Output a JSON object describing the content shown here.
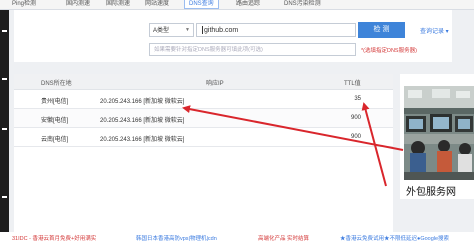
{
  "nav": {
    "tabs": [
      "Ping检测",
      "国内测速",
      "国际测速",
      "网站速度",
      "DNS查询",
      "路由追踪",
      "DNS污染检测"
    ],
    "active_index": 4
  },
  "query": {
    "record_type": "A类型",
    "domain": "github.com",
    "detect_label": "检 测",
    "history_label": "查询记录 ▾",
    "dns_placeholder": "如果需要针对指定DNS服务器可填此项(可选)",
    "optional_note": "*(选填指定DNS服务器)"
  },
  "table": {
    "headers": [
      "DNS所在地",
      "响应IP",
      "TTL值"
    ],
    "rows": [
      {
        "location": "贵州[电信]",
        "ip": "20.205.243.166 [新加坡 微软云]",
        "ttl": "35"
      },
      {
        "location": "安徽[电信]",
        "ip": "20.205.243.166 [新加坡 微软云]",
        "ttl": "900"
      },
      {
        "location": "云南[电信]",
        "ip": "20.205.243.166 [新加坡 微软云]",
        "ttl": "900"
      }
    ]
  },
  "ad": {
    "caption": "外包服务网",
    "close_icon": "x"
  },
  "bottom_ads": [
    "31IDC - 香港云首月免费+好用满实",
    "韩国日本香港高防vps|物理机|cdn",
    "高端化产品 实时结算",
    "★香港云免费试用★不限低延迟●Google搜索"
  ],
  "colors": {
    "accent": "#3e84d9",
    "note_red": "#d43a3a",
    "arrow_red": "#d9262c"
  }
}
